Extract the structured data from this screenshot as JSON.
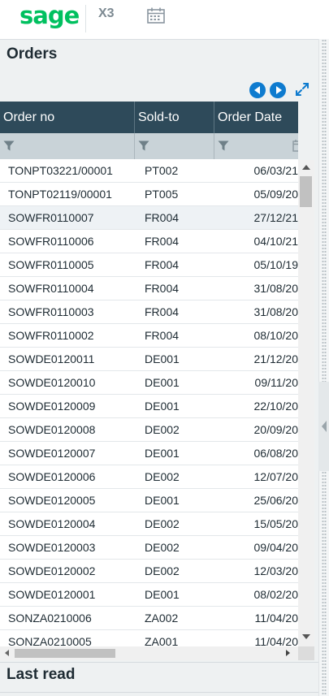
{
  "header": {
    "logo": "sage",
    "product": "X3",
    "calendar_icon": "calendar-icon"
  },
  "panel": {
    "title": "Orders",
    "nav_prev_icon": "arrow-left-circle-icon",
    "nav_next_icon": "arrow-right-circle-icon",
    "expand_icon": "expand-arrows-icon"
  },
  "grid": {
    "columns": [
      "Order no",
      "Sold-to",
      "Order Date"
    ],
    "rows": [
      {
        "order_no": "TONPT03221/00001",
        "sold_to": "PT002",
        "date": "06/03/21"
      },
      {
        "order_no": "TONPT02119/00001",
        "sold_to": "PT005",
        "date": "05/09/20"
      },
      {
        "order_no": "SOWFR0110007",
        "sold_to": "FR004",
        "date": "27/12/21"
      },
      {
        "order_no": "SOWFR0110006",
        "sold_to": "FR004",
        "date": "04/10/21"
      },
      {
        "order_no": "SOWFR0110005",
        "sold_to": "FR004",
        "date": "05/10/19"
      },
      {
        "order_no": "SOWFR0110004",
        "sold_to": "FR004",
        "date": "31/08/20"
      },
      {
        "order_no": "SOWFR0110003",
        "sold_to": "FR004",
        "date": "31/08/20"
      },
      {
        "order_no": "SOWFR0110002",
        "sold_to": "FR004",
        "date": "08/10/20"
      },
      {
        "order_no": "SOWDE0120011",
        "sold_to": "DE001",
        "date": "21/12/20"
      },
      {
        "order_no": "SOWDE0120010",
        "sold_to": "DE001",
        "date": "09/11/20"
      },
      {
        "order_no": "SOWDE0120009",
        "sold_to": "DE001",
        "date": "22/10/20"
      },
      {
        "order_no": "SOWDE0120008",
        "sold_to": "DE002",
        "date": "20/09/20"
      },
      {
        "order_no": "SOWDE0120007",
        "sold_to": "DE001",
        "date": "06/08/20"
      },
      {
        "order_no": "SOWDE0120006",
        "sold_to": "DE002",
        "date": "12/07/20"
      },
      {
        "order_no": "SOWDE0120005",
        "sold_to": "DE001",
        "date": "25/06/20"
      },
      {
        "order_no": "SOWDE0120004",
        "sold_to": "DE002",
        "date": "15/05/20"
      },
      {
        "order_no": "SOWDE0120003",
        "sold_to": "DE002",
        "date": "09/04/20"
      },
      {
        "order_no": "SOWDE0120002",
        "sold_to": "DE002",
        "date": "12/03/20"
      },
      {
        "order_no": "SOWDE0120001",
        "sold_to": "DE001",
        "date": "08/02/20"
      },
      {
        "order_no": "SONZA0210006",
        "sold_to": "ZA002",
        "date": "11/04/20"
      },
      {
        "order_no": "SONZA0210005",
        "sold_to": "ZA001",
        "date": "11/04/20"
      }
    ],
    "selected_row": 2
  },
  "footer": {
    "section_title": "Last read"
  },
  "colors": {
    "brand": "#00c05f",
    "header_bg": "#2e4a5a",
    "filter_bg": "#c9d3d8",
    "accent_blue": "#0e7bcf"
  }
}
